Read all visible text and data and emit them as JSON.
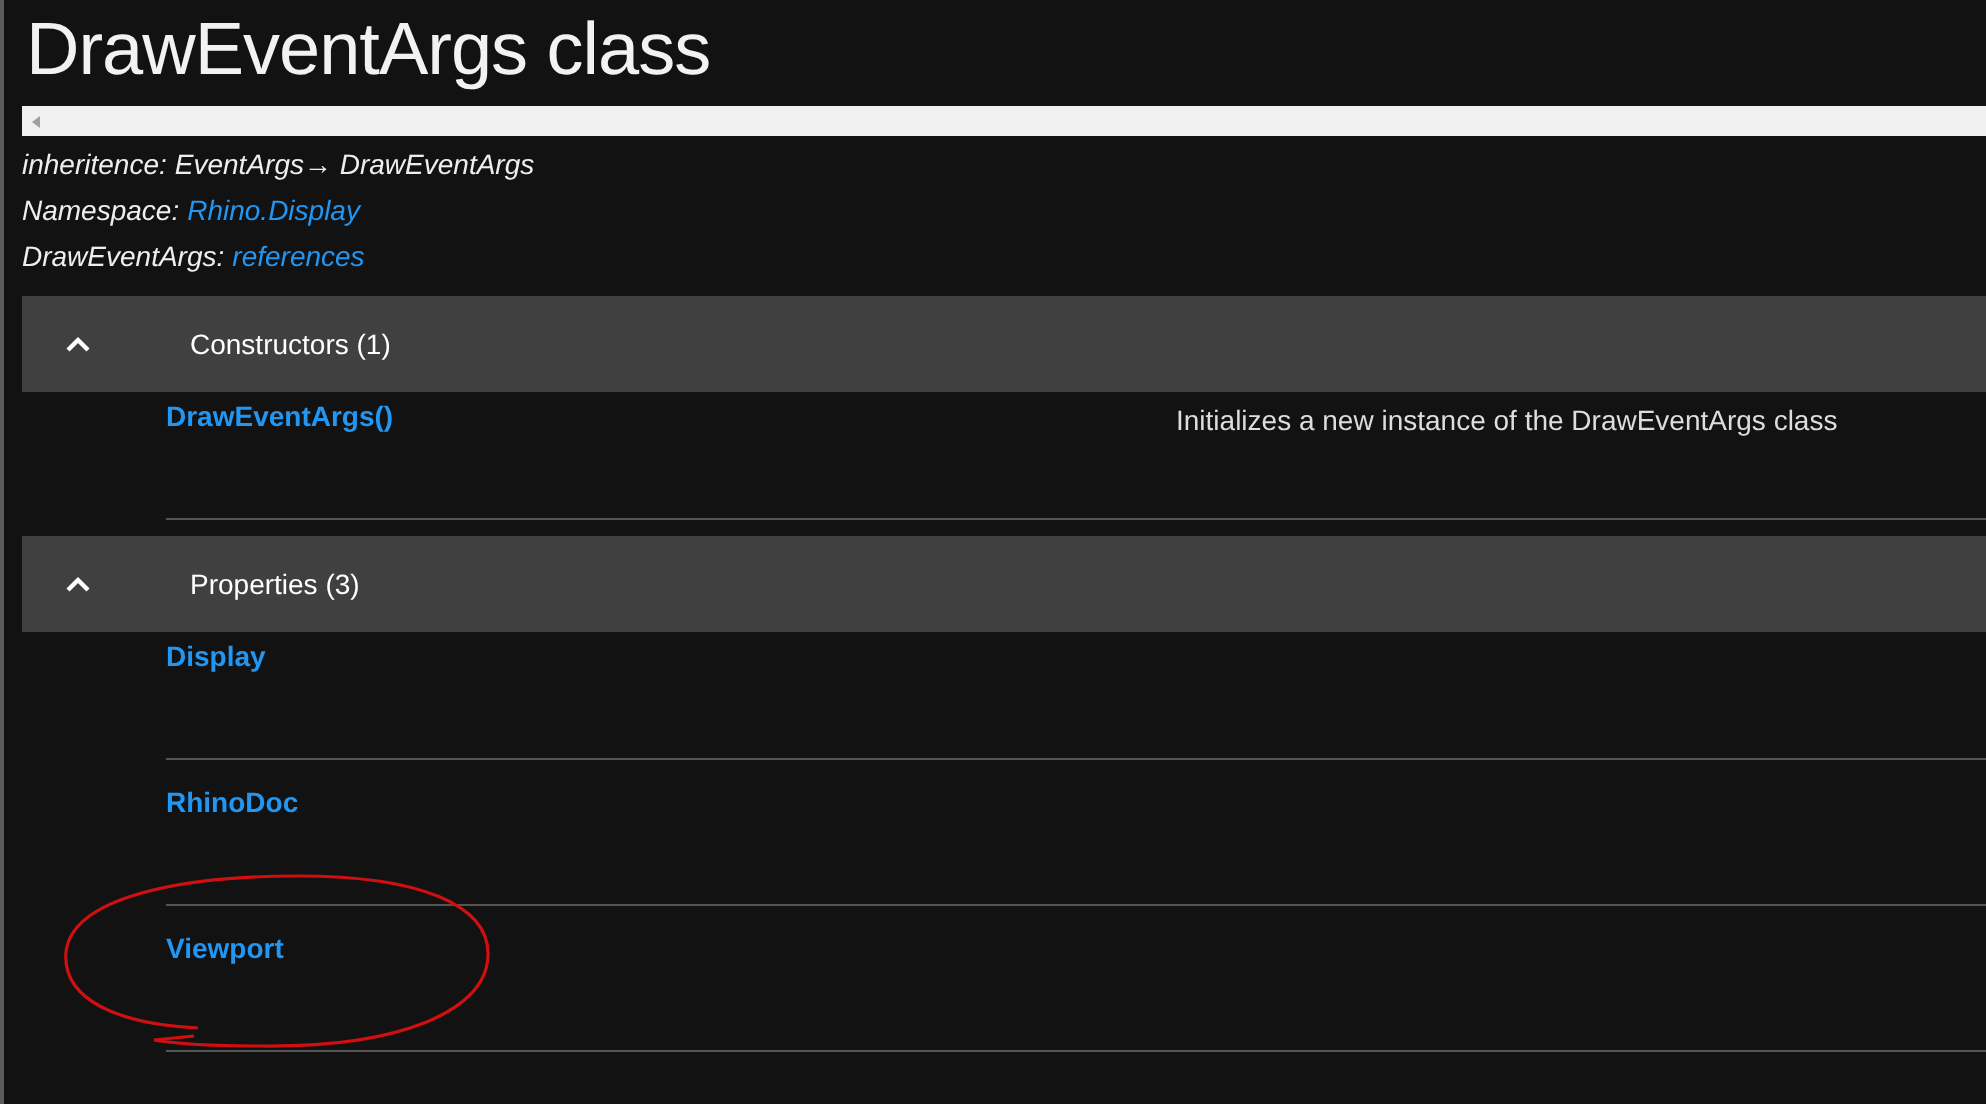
{
  "title": "DrawEventArgs class",
  "info": [
    {
      "label": "inheritence:",
      "value": "EventArgs→ DrawEventArgs",
      "kind": "text"
    },
    {
      "label": "Namespace:",
      "value": "Rhino.Display",
      "kind": "link"
    },
    {
      "label": "DrawEventArgs:",
      "value": "references",
      "kind": "link"
    }
  ],
  "sections": [
    {
      "title": "Constructors (1)",
      "expanded": true,
      "items": [
        {
          "name": "DrawEventArgs()",
          "description": "Initializes a new instance of the DrawEventArgs class",
          "circled": false
        }
      ]
    },
    {
      "title": "Properties (3)",
      "expanded": true,
      "items": [
        {
          "name": "Display",
          "circled": false
        },
        {
          "name": "RhinoDoc",
          "circled": false
        },
        {
          "name": "Viewport",
          "circled": true
        }
      ]
    }
  ]
}
